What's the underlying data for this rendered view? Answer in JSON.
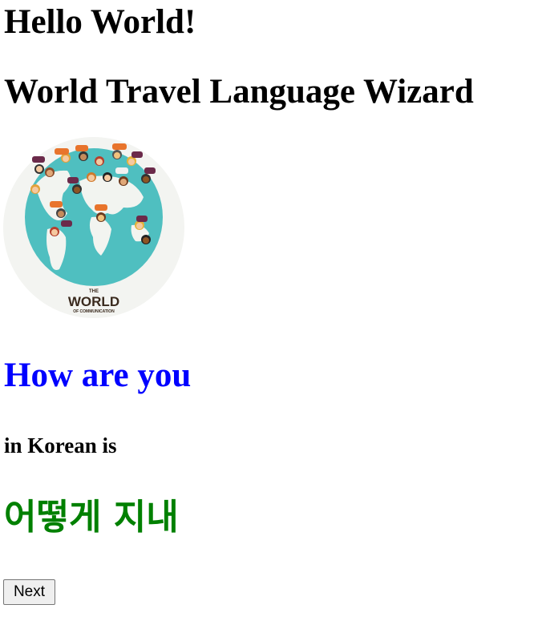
{
  "page": {
    "greeting": "Hello World!",
    "title": "World Travel Language Wizard"
  },
  "image": {
    "logo_line1": "THE",
    "logo_line2": "WORLD",
    "logo_line3": "OF COMMUNICATION"
  },
  "lesson": {
    "phrase": "How are you",
    "language_label": "in Korean is",
    "translation": "어떻게 지내",
    "next_label": "Next"
  },
  "colors": {
    "phrase": "#0000ff",
    "translation": "#008000",
    "ocean": "#4fbfc0",
    "land": "#f2f4f0"
  }
}
